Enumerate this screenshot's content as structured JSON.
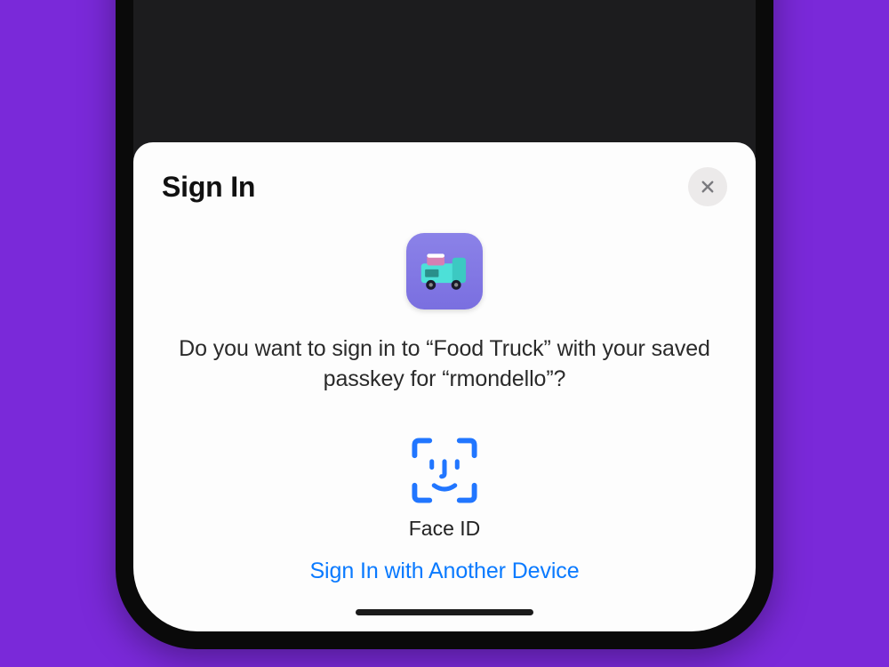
{
  "sheet": {
    "title": "Sign In",
    "prompt": "Do you want to sign in to “Food Truck” with your saved passkey for “rmondello”?",
    "auth_method_label": "Face ID",
    "alt_link_label": "Sign In with Another Device",
    "app_name": "Food Truck",
    "username": "rmondello"
  },
  "colors": {
    "background": "#7a29d9",
    "link": "#0a7aff",
    "faceid": "#2176ff"
  }
}
